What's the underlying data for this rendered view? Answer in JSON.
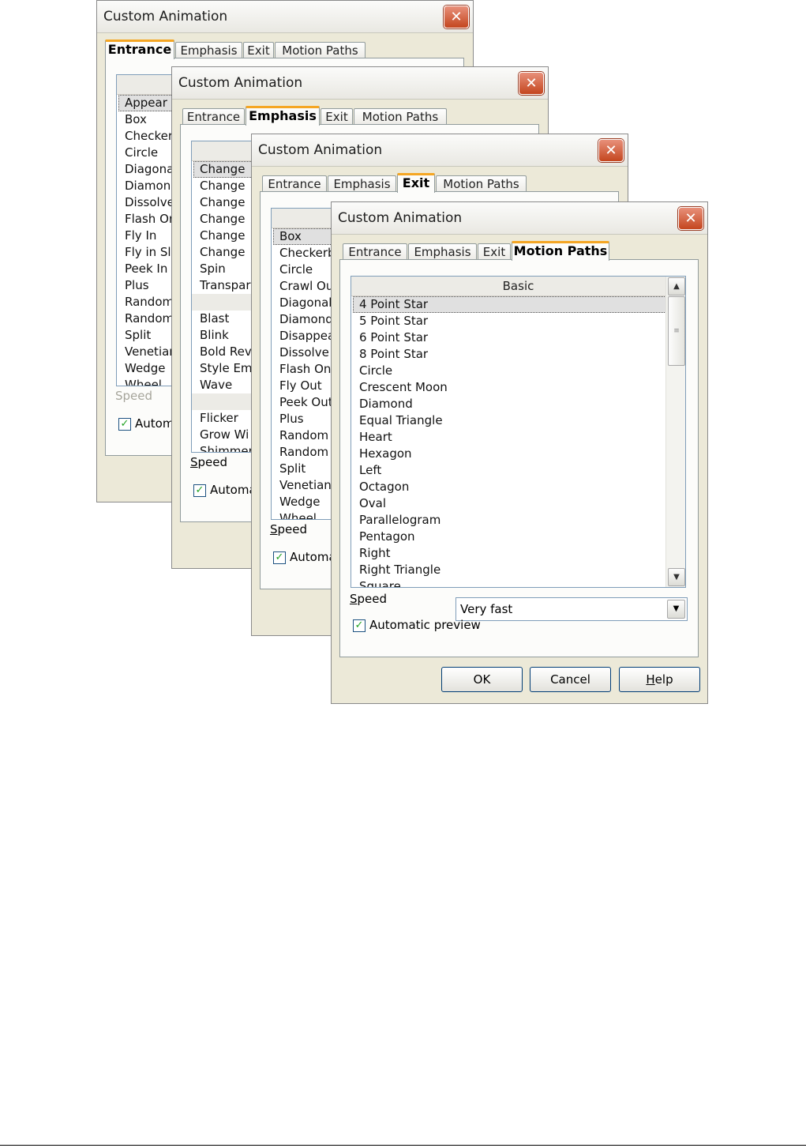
{
  "dialogs": [
    {
      "title": "Custom Animation",
      "tabs": [
        "Entrance",
        "Emphasis",
        "Exit",
        "Motion Paths"
      ],
      "active_tab": "Entrance",
      "items": [
        "Appear",
        "Box",
        "Checker",
        "Circle",
        "Diagona",
        "Diamond",
        "Dissolve",
        "Flash Or",
        "Fly In",
        "Fly in Slo",
        "Peek In",
        "Plus",
        "Random",
        "Random",
        "Split",
        "Venetian",
        "Wedge",
        "Wheel"
      ],
      "speed_label": "Speed",
      "auto_label": "Autom"
    },
    {
      "title": "Custom Animation",
      "tabs": [
        "Entrance",
        "Emphasis",
        "Exit",
        "Motion Paths"
      ],
      "active_tab": "Emphasis",
      "items": [
        "Change",
        "Change",
        "Change",
        "Change",
        "Change",
        "Change",
        "Spin",
        "Transpar",
        "",
        "Blast",
        "Blink",
        "Bold Rev",
        "Style Em",
        "Wave",
        "",
        "Flicker",
        "Grow Wi",
        "Shimmer"
      ],
      "speed_label": "Speed",
      "auto_label": "Automa"
    },
    {
      "title": "Custom Animation",
      "tabs": [
        "Entrance",
        "Emphasis",
        "Exit",
        "Motion Paths"
      ],
      "active_tab": "Exit",
      "items": [
        "Box",
        "Checkerb",
        "Circle",
        "Crawl Ou",
        "Diagonal",
        "Diamond",
        "Disappea",
        "Dissolve",
        "Flash On",
        "Fly Out",
        "Peek Out",
        "Plus",
        "Random",
        "Random",
        "Split",
        "Venetian",
        "Wedge",
        "Wheel"
      ],
      "speed_label": "Speed",
      "auto_label": "Automa"
    },
    {
      "title": "Custom Animation",
      "tabs": [
        "Entrance",
        "Emphasis",
        "Exit",
        "Motion Paths"
      ],
      "active_tab": "Motion Paths",
      "list_header": "Basic",
      "items": [
        "4 Point Star",
        "5 Point Star",
        "6 Point Star",
        "8 Point Star",
        "Circle",
        "Crescent Moon",
        "Diamond",
        "Equal Triangle",
        "Heart",
        "Hexagon",
        "Left",
        "Octagon",
        "Oval",
        "Parallelogram",
        "Pentagon",
        "Right",
        "Right Triangle",
        "Square"
      ],
      "speed_label": "Speed",
      "speed_value": "Very fast",
      "auto_label": "Automatic preview",
      "buttons": {
        "ok": "OK",
        "cancel": "Cancel",
        "help": "Help"
      }
    }
  ],
  "colors": {
    "dialog_bg": "#ece9d8",
    "tab_accent": "#f5a623",
    "close_red": "#c4461f",
    "check_green": "#21a121"
  }
}
